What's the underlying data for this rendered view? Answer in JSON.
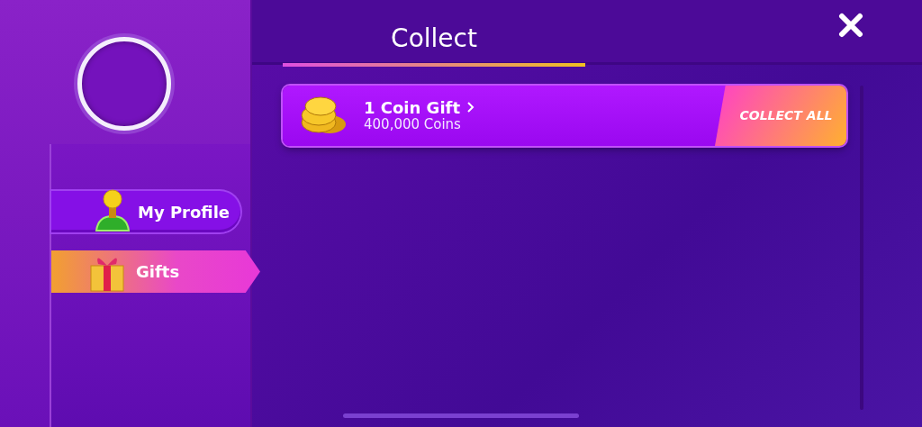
{
  "sidebar": {
    "items": [
      {
        "kind": "profile",
        "label": "My Profile",
        "selected": false
      },
      {
        "kind": "gifts",
        "label": "Gifts",
        "selected": true
      }
    ]
  },
  "tabs": [
    {
      "label": "Collect",
      "selected": true
    }
  ],
  "gifts": [
    {
      "title": "1 Coin Gift",
      "subtitle": "400,000 Coins",
      "action": "COLLECT ALL"
    }
  ]
}
